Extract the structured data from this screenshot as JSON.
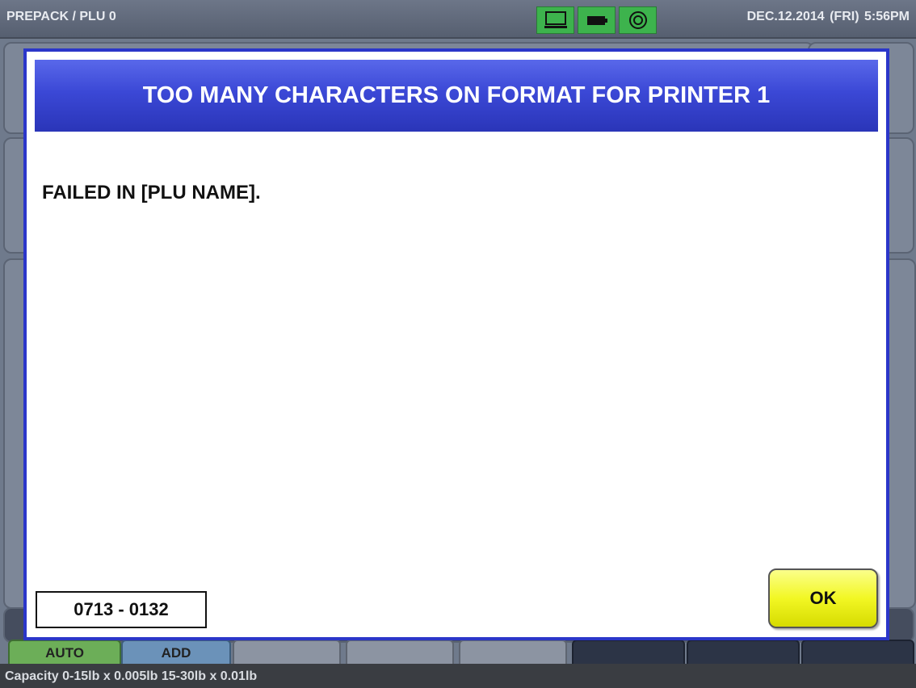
{
  "header": {
    "title": "PREPACK / PLU 0",
    "datetime": "DEC.12.2014 (FRI)  5:56PM",
    "status_icons": [
      "monitor-icon",
      "battery-icon",
      "network-signal-icon"
    ]
  },
  "background": {
    "tabs": [
      "AUTO",
      "ADD"
    ]
  },
  "dialog": {
    "title": "TOO MANY CHARACTERS ON FORMAT FOR PRINTER 1",
    "message": "FAILED IN [PLU NAME].",
    "error_code": "0713 - 0132",
    "ok_label": "OK"
  },
  "footer": {
    "capacity": "Capacity 0-15lb x 0.005lb  15-30lb x 0.01lb"
  },
  "colors": {
    "dialog_border": "#2b36c9",
    "header_gradient_top": "#5968ea",
    "header_gradient_bottom": "#2a35b8",
    "ok_button": "#f2f724",
    "status_icon_bg": "#3db34d"
  }
}
